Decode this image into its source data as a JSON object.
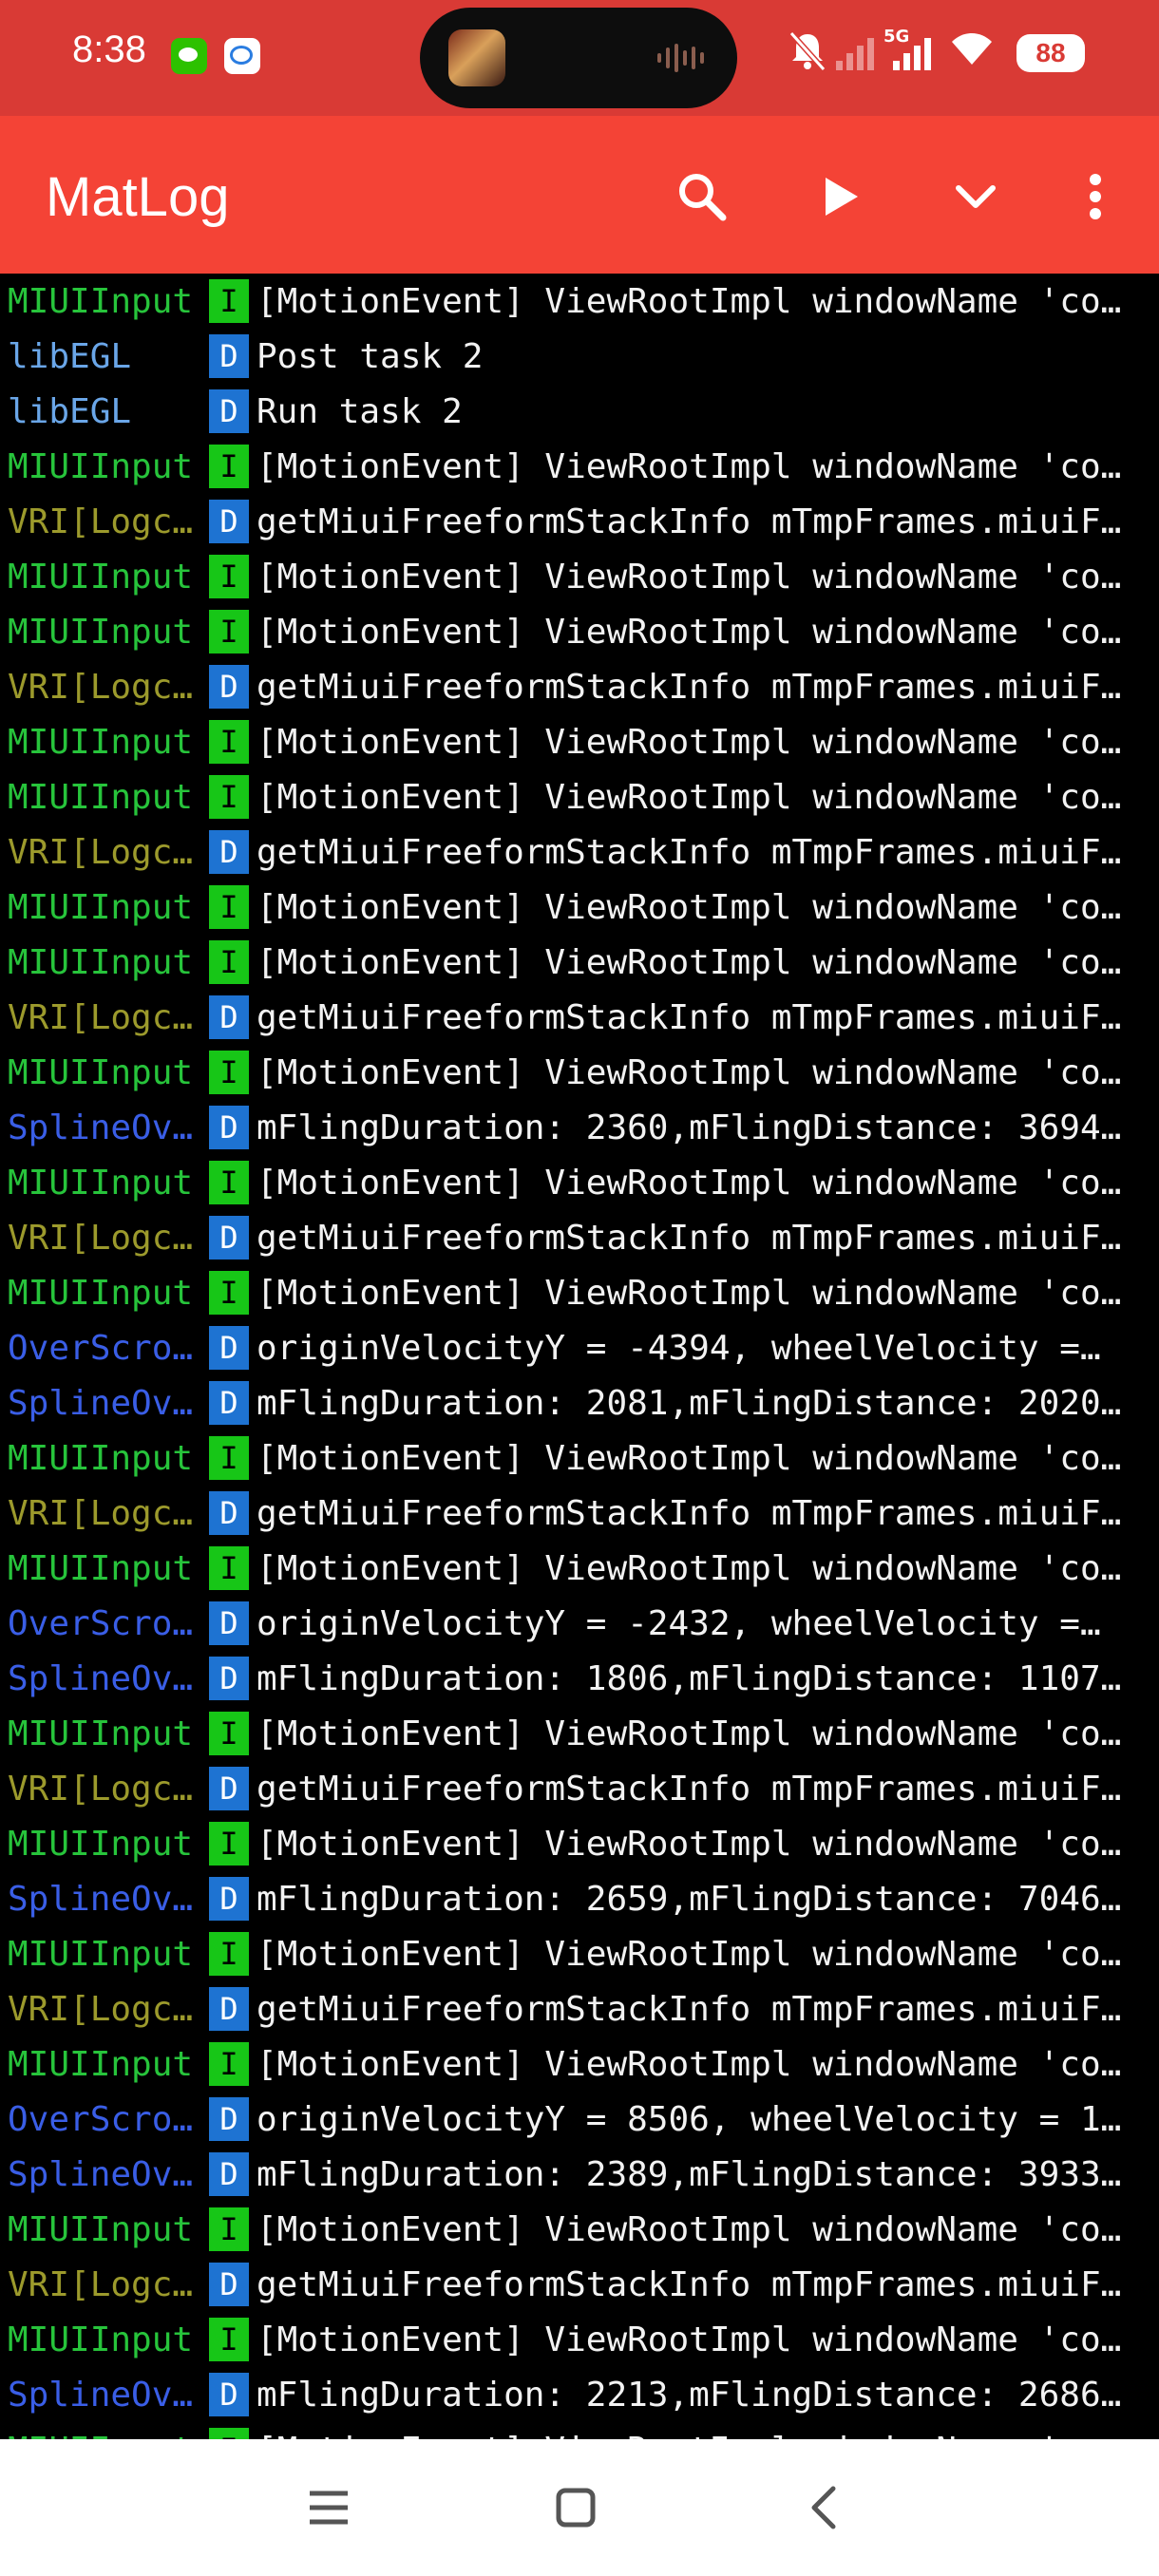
{
  "status_bar": {
    "time": "8:38",
    "network": "5G",
    "battery": "88"
  },
  "app_bar": {
    "title": "MatLog"
  },
  "tag_colors": {
    "MIUIInput": "#27c43b",
    "libEGL": "#6aa6e8",
    "VRI[Logc…": "#9c9a2c",
    "SplineOv…": "#3a5ee6",
    "OverScro…": "#3a5ee6"
  },
  "log_rows": [
    {
      "tag": "MIUIInput",
      "level": "I",
      "message": "[MotionEvent] ViewRootImpl windowName 'co…"
    },
    {
      "tag": "libEGL",
      "level": "D",
      "message": "Post task 2"
    },
    {
      "tag": "libEGL",
      "level": "D",
      "message": "Run task 2"
    },
    {
      "tag": "MIUIInput",
      "level": "I",
      "message": "[MotionEvent] ViewRootImpl windowName 'co…"
    },
    {
      "tag": "VRI[Logc…",
      "level": "D",
      "message": "getMiuiFreeformStackInfo mTmpFrames.miuiF…"
    },
    {
      "tag": "MIUIInput",
      "level": "I",
      "message": "[MotionEvent] ViewRootImpl windowName 'co…"
    },
    {
      "tag": "MIUIInput",
      "level": "I",
      "message": "[MotionEvent] ViewRootImpl windowName 'co…"
    },
    {
      "tag": "VRI[Logc…",
      "level": "D",
      "message": "getMiuiFreeformStackInfo mTmpFrames.miuiF…"
    },
    {
      "tag": "MIUIInput",
      "level": "I",
      "message": "[MotionEvent] ViewRootImpl windowName 'co…"
    },
    {
      "tag": "MIUIInput",
      "level": "I",
      "message": "[MotionEvent] ViewRootImpl windowName 'co…"
    },
    {
      "tag": "VRI[Logc…",
      "level": "D",
      "message": "getMiuiFreeformStackInfo mTmpFrames.miuiF…"
    },
    {
      "tag": "MIUIInput",
      "level": "I",
      "message": "[MotionEvent] ViewRootImpl windowName 'co…"
    },
    {
      "tag": "MIUIInput",
      "level": "I",
      "message": "[MotionEvent] ViewRootImpl windowName 'co…"
    },
    {
      "tag": "VRI[Logc…",
      "level": "D",
      "message": "getMiuiFreeformStackInfo mTmpFrames.miuiF…"
    },
    {
      "tag": "MIUIInput",
      "level": "I",
      "message": "[MotionEvent] ViewRootImpl windowName 'co…"
    },
    {
      "tag": "SplineOv…",
      "level": "D",
      "message": "mFlingDuration: 2360,mFlingDistance: 3694…"
    },
    {
      "tag": "MIUIInput",
      "level": "I",
      "message": "[MotionEvent] ViewRootImpl windowName 'co…"
    },
    {
      "tag": "VRI[Logc…",
      "level": "D",
      "message": "getMiuiFreeformStackInfo mTmpFrames.miuiF…"
    },
    {
      "tag": "MIUIInput",
      "level": "I",
      "message": "[MotionEvent] ViewRootImpl windowName 'co…"
    },
    {
      "tag": "OverScro…",
      "level": "D",
      "message": "originVelocityY = -4394, wheelVelocity =…"
    },
    {
      "tag": "SplineOv…",
      "level": "D",
      "message": "mFlingDuration: 2081,mFlingDistance: 2020…"
    },
    {
      "tag": "MIUIInput",
      "level": "I",
      "message": "[MotionEvent] ViewRootImpl windowName 'co…"
    },
    {
      "tag": "VRI[Logc…",
      "level": "D",
      "message": "getMiuiFreeformStackInfo mTmpFrames.miuiF…"
    },
    {
      "tag": "MIUIInput",
      "level": "I",
      "message": "[MotionEvent] ViewRootImpl windowName 'co…"
    },
    {
      "tag": "OverScro…",
      "level": "D",
      "message": "originVelocityY = -2432, wheelVelocity =…"
    },
    {
      "tag": "SplineOv…",
      "level": "D",
      "message": "mFlingDuration: 1806,mFlingDistance: 1107…"
    },
    {
      "tag": "MIUIInput",
      "level": "I",
      "message": "[MotionEvent] ViewRootImpl windowName 'co…"
    },
    {
      "tag": "VRI[Logc…",
      "level": "D",
      "message": "getMiuiFreeformStackInfo mTmpFrames.miuiF…"
    },
    {
      "tag": "MIUIInput",
      "level": "I",
      "message": "[MotionEvent] ViewRootImpl windowName 'co…"
    },
    {
      "tag": "SplineOv…",
      "level": "D",
      "message": "mFlingDuration: 2659,mFlingDistance: 7046…"
    },
    {
      "tag": "MIUIInput",
      "level": "I",
      "message": "[MotionEvent] ViewRootImpl windowName 'co…"
    },
    {
      "tag": "VRI[Logc…",
      "level": "D",
      "message": "getMiuiFreeformStackInfo mTmpFrames.miuiF…"
    },
    {
      "tag": "MIUIInput",
      "level": "I",
      "message": "[MotionEvent] ViewRootImpl windowName 'co…"
    },
    {
      "tag": "OverScro…",
      "level": "D",
      "message": "originVelocityY = 8506, wheelVelocity = 1…"
    },
    {
      "tag": "SplineOv…",
      "level": "D",
      "message": "mFlingDuration: 2389,mFlingDistance: 3933…"
    },
    {
      "tag": "MIUIInput",
      "level": "I",
      "message": "[MotionEvent] ViewRootImpl windowName 'co…"
    },
    {
      "tag": "VRI[Logc…",
      "level": "D",
      "message": "getMiuiFreeformStackInfo mTmpFrames.miuiF…"
    },
    {
      "tag": "MIUIInput",
      "level": "I",
      "message": "[MotionEvent] ViewRootImpl windowName 'co…"
    },
    {
      "tag": "SplineOv…",
      "level": "D",
      "message": "mFlingDuration: 2213,mFlingDistance: 2686…"
    },
    {
      "tag": "MIUIInput",
      "level": "I",
      "message": "[MotionEvent] ViewRootImpl windowName 'co…"
    }
  ]
}
